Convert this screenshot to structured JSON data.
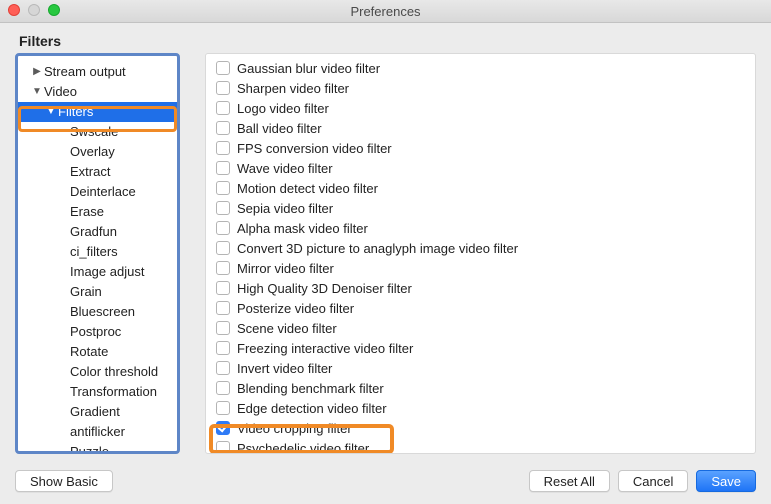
{
  "window": {
    "title": "Preferences"
  },
  "page_header": "Filters",
  "sidebar": {
    "items": [
      {
        "label": "Stream output",
        "level": 0,
        "expanded": false,
        "arrow": "▶"
      },
      {
        "label": "Video",
        "level": 0,
        "expanded": true,
        "arrow": "▼"
      },
      {
        "label": "Filters",
        "level": 1,
        "expanded": true,
        "arrow": "▼",
        "selected": true
      },
      {
        "label": "Swscale",
        "level": 2
      },
      {
        "label": "Overlay",
        "level": 2
      },
      {
        "label": "Extract",
        "level": 2
      },
      {
        "label": "Deinterlace",
        "level": 2
      },
      {
        "label": "Erase",
        "level": 2
      },
      {
        "label": "Gradfun",
        "level": 2
      },
      {
        "label": "ci_filters",
        "level": 2
      },
      {
        "label": "Image adjust",
        "level": 2
      },
      {
        "label": "Grain",
        "level": 2
      },
      {
        "label": "Bluescreen",
        "level": 2
      },
      {
        "label": "Postproc",
        "level": 2
      },
      {
        "label": "Rotate",
        "level": 2
      },
      {
        "label": "Color threshold",
        "level": 2
      },
      {
        "label": "Transformation",
        "level": 2
      },
      {
        "label": "Gradient",
        "level": 2
      },
      {
        "label": "antiflicker",
        "level": 2
      },
      {
        "label": "Puzzle",
        "level": 2
      }
    ]
  },
  "filters": [
    {
      "label": "Gaussian blur video filter",
      "checked": false
    },
    {
      "label": "Sharpen video filter",
      "checked": false
    },
    {
      "label": "Logo video filter",
      "checked": false
    },
    {
      "label": "Ball video filter",
      "checked": false
    },
    {
      "label": "FPS conversion video filter",
      "checked": false
    },
    {
      "label": "Wave video filter",
      "checked": false
    },
    {
      "label": "Motion detect video filter",
      "checked": false
    },
    {
      "label": "Sepia video filter",
      "checked": false
    },
    {
      "label": "Alpha mask video filter",
      "checked": false
    },
    {
      "label": "Convert 3D picture to anaglyph image video filter",
      "checked": false
    },
    {
      "label": "Mirror video filter",
      "checked": false
    },
    {
      "label": "High Quality 3D Denoiser filter",
      "checked": false
    },
    {
      "label": "Posterize video filter",
      "checked": false
    },
    {
      "label": "Scene video filter",
      "checked": false
    },
    {
      "label": "Freezing interactive video filter",
      "checked": false
    },
    {
      "label": "Invert video filter",
      "checked": false
    },
    {
      "label": "Blending benchmark filter",
      "checked": false
    },
    {
      "label": "Edge detection video filter",
      "checked": false
    },
    {
      "label": "Video cropping filter",
      "checked": true
    },
    {
      "label": "Psychedelic video filter",
      "checked": false
    }
  ],
  "buttons": {
    "show_basic": "Show Basic",
    "reset_all": "Reset All",
    "cancel": "Cancel",
    "save": "Save"
  }
}
